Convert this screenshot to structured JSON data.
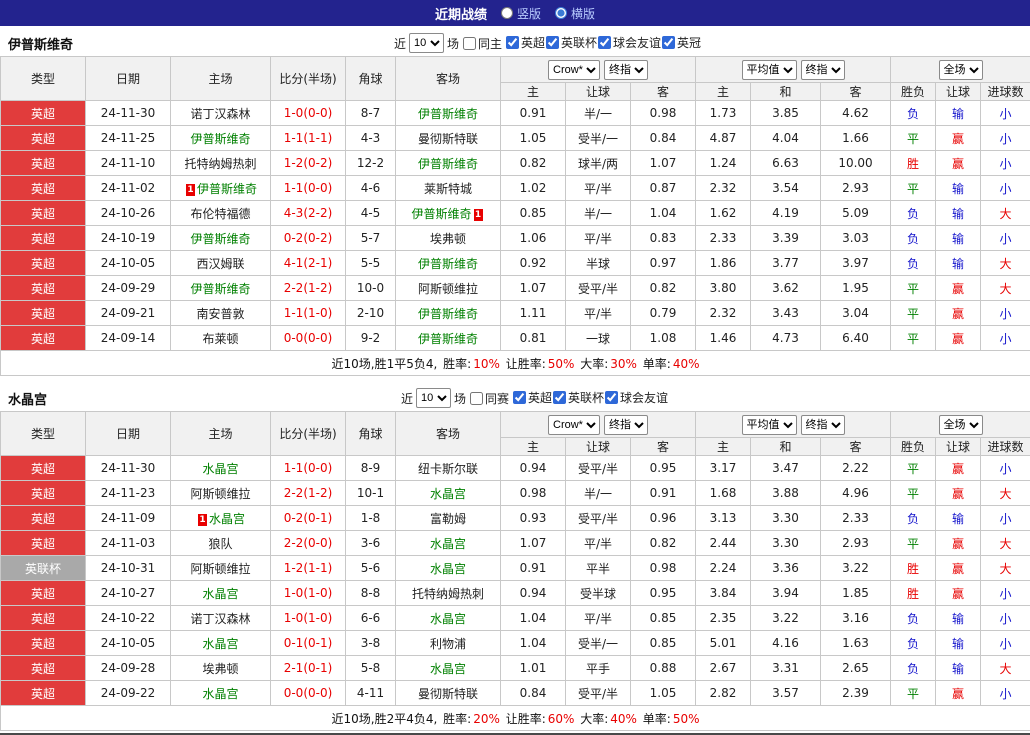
{
  "topbar": {
    "title": "近期战绩",
    "layout_options": {
      "vertical": "竖版",
      "horizontal": "横版"
    },
    "layout_selected": "横版"
  },
  "colors": {
    "accent_bar": "#23238e",
    "focus_team": "#008000",
    "score": "#e80000",
    "value_colors": {
      "胜": "#e80000",
      "平": "#008000",
      "负": "#1414cc",
      "赢": "#e80000",
      "输": "#1414cc",
      "大": "#e80000",
      "小": "#1414cc"
    },
    "type_colors": {
      "英超": "#e13c3c",
      "英联杯": "#a9a9a9"
    }
  },
  "table_header": {
    "cols": [
      "类型",
      "日期",
      "主场",
      "比分(半场)",
      "角球",
      "客场"
    ],
    "group1": {
      "select1": "Crow*",
      "select2": "终指",
      "subs": [
        "主",
        "让球",
        "客"
      ]
    },
    "group2": {
      "select1": "平均值",
      "select2": "终指",
      "subs": [
        "主",
        "和",
        "客"
      ]
    },
    "group3": {
      "select": "全场",
      "subs": [
        "胜负",
        "让球",
        "进球数"
      ]
    }
  },
  "sections": [
    {
      "team": "伊普斯维奇",
      "filter": {
        "near_label": "近",
        "count": "10",
        "matches_label": "场",
        "same_label": "同主",
        "same_checked": false,
        "leagues": [
          {
            "label": "英超",
            "checked": true
          },
          {
            "label": "英联杯",
            "checked": true
          },
          {
            "label": "球会友谊",
            "checked": true
          },
          {
            "label": "英冠",
            "checked": true
          }
        ]
      },
      "rows": [
        {
          "type": "英超",
          "date": "24-11-30",
          "home": {
            "name": "诺丁汉森林"
          },
          "score": "1-0(0-0)",
          "corner": "8-7",
          "away": {
            "name": "伊普斯维奇",
            "focus": true
          },
          "odds": [
            "0.91",
            "半/一",
            "0.98"
          ],
          "avg": [
            "1.73",
            "3.85",
            "4.62"
          ],
          "result": "负",
          "handicap_result": "输",
          "goals": "小"
        },
        {
          "type": "英超",
          "date": "24-11-25",
          "home": {
            "name": "伊普斯维奇",
            "focus": true
          },
          "score": "1-1(1-1)",
          "corner": "4-3",
          "away": {
            "name": "曼彻斯特联"
          },
          "odds": [
            "1.05",
            "受半/一",
            "0.84"
          ],
          "avg": [
            "4.87",
            "4.04",
            "1.66"
          ],
          "result": "平",
          "handicap_result": "赢",
          "goals": "小"
        },
        {
          "type": "英超",
          "date": "24-11-10",
          "home": {
            "name": "托特纳姆热刺"
          },
          "score": "1-2(0-2)",
          "corner": "12-2",
          "away": {
            "name": "伊普斯维奇",
            "focus": true
          },
          "odds": [
            "0.82",
            "球半/两",
            "1.07"
          ],
          "avg": [
            "1.24",
            "6.63",
            "10.00"
          ],
          "result": "胜",
          "handicap_result": "赢",
          "goals": "小"
        },
        {
          "type": "英超",
          "date": "24-11-02",
          "home": {
            "name": "伊普斯维奇",
            "focus": true,
            "card": "1",
            "card_pos": "left"
          },
          "score": "1-1(0-0)",
          "corner": "4-6",
          "away": {
            "name": "莱斯特城"
          },
          "odds": [
            "1.02",
            "平/半",
            "0.87"
          ],
          "avg": [
            "2.32",
            "3.54",
            "2.93"
          ],
          "result": "平",
          "handicap_result": "输",
          "goals": "小"
        },
        {
          "type": "英超",
          "date": "24-10-26",
          "home": {
            "name": "布伦特福德"
          },
          "score": "4-3(2-2)",
          "corner": "4-5",
          "away": {
            "name": "伊普斯维奇",
            "focus": true,
            "card": "1",
            "card_pos": "right"
          },
          "odds": [
            "0.85",
            "半/一",
            "1.04"
          ],
          "avg": [
            "1.62",
            "4.19",
            "5.09"
          ],
          "result": "负",
          "handicap_result": "输",
          "goals": "大"
        },
        {
          "type": "英超",
          "date": "24-10-19",
          "home": {
            "name": "伊普斯维奇",
            "focus": true
          },
          "score": "0-2(0-2)",
          "corner": "5-7",
          "away": {
            "name": "埃弗顿"
          },
          "odds": [
            "1.06",
            "平/半",
            "0.83"
          ],
          "avg": [
            "2.33",
            "3.39",
            "3.03"
          ],
          "result": "负",
          "handicap_result": "输",
          "goals": "小"
        },
        {
          "type": "英超",
          "date": "24-10-05",
          "home": {
            "name": "西汉姆联"
          },
          "score": "4-1(2-1)",
          "corner": "5-5",
          "away": {
            "name": "伊普斯维奇",
            "focus": true
          },
          "odds": [
            "0.92",
            "半球",
            "0.97"
          ],
          "avg": [
            "1.86",
            "3.77",
            "3.97"
          ],
          "result": "负",
          "handicap_result": "输",
          "goals": "大"
        },
        {
          "type": "英超",
          "date": "24-09-29",
          "home": {
            "name": "伊普斯维奇",
            "focus": true
          },
          "score": "2-2(1-2)",
          "corner": "10-0",
          "away": {
            "name": "阿斯顿维拉"
          },
          "odds": [
            "1.07",
            "受平/半",
            "0.82"
          ],
          "avg": [
            "3.80",
            "3.62",
            "1.95"
          ],
          "result": "平",
          "handicap_result": "赢",
          "goals": "大"
        },
        {
          "type": "英超",
          "date": "24-09-21",
          "home": {
            "name": "南安普敦"
          },
          "score": "1-1(1-0)",
          "corner": "2-10",
          "away": {
            "name": "伊普斯维奇",
            "focus": true
          },
          "odds": [
            "1.11",
            "平/半",
            "0.79"
          ],
          "avg": [
            "2.32",
            "3.43",
            "3.04"
          ],
          "result": "平",
          "handicap_result": "赢",
          "goals": "小"
        },
        {
          "type": "英超",
          "date": "24-09-14",
          "home": {
            "name": "布莱顿"
          },
          "score": "0-0(0-0)",
          "corner": "9-2",
          "away": {
            "name": "伊普斯维奇",
            "focus": true
          },
          "odds": [
            "0.81",
            "一球",
            "1.08"
          ],
          "avg": [
            "1.46",
            "4.73",
            "6.40"
          ],
          "result": "平",
          "handicap_result": "赢",
          "goals": "小"
        }
      ],
      "summary": {
        "prefix": "近10场,胜1平5负4,",
        "stats": [
          {
            "label": "胜率:",
            "value": "10%"
          },
          {
            "label": "让胜率:",
            "value": "50%"
          },
          {
            "label": "大率:",
            "value": "30%"
          },
          {
            "label": "单率:",
            "value": "40%"
          }
        ]
      }
    },
    {
      "team": "水晶宫",
      "filter": {
        "near_label": "近",
        "count": "10",
        "matches_label": "场",
        "same_label": "同赛",
        "same_checked": false,
        "leagues": [
          {
            "label": "英超",
            "checked": true
          },
          {
            "label": "英联杯",
            "checked": true
          },
          {
            "label": "球会友谊",
            "checked": true
          }
        ]
      },
      "rows": [
        {
          "type": "英超",
          "date": "24-11-30",
          "home": {
            "name": "水晶宫",
            "focus": true
          },
          "score": "1-1(0-0)",
          "corner": "8-9",
          "away": {
            "name": "纽卡斯尔联"
          },
          "odds": [
            "0.94",
            "受平/半",
            "0.95"
          ],
          "avg": [
            "3.17",
            "3.47",
            "2.22"
          ],
          "result": "平",
          "handicap_result": "赢",
          "goals": "小"
        },
        {
          "type": "英超",
          "date": "24-11-23",
          "home": {
            "name": "阿斯顿维拉"
          },
          "score": "2-2(1-2)",
          "corner": "10-1",
          "away": {
            "name": "水晶宫",
            "focus": true
          },
          "odds": [
            "0.98",
            "半/一",
            "0.91"
          ],
          "avg": [
            "1.68",
            "3.88",
            "4.96"
          ],
          "result": "平",
          "handicap_result": "赢",
          "goals": "大"
        },
        {
          "type": "英超",
          "date": "24-11-09",
          "home": {
            "name": "水晶宫",
            "focus": true,
            "card": "1",
            "card_pos": "left"
          },
          "score": "0-2(0-1)",
          "corner": "1-8",
          "away": {
            "name": "富勒姆"
          },
          "odds": [
            "0.93",
            "受平/半",
            "0.96"
          ],
          "avg": [
            "3.13",
            "3.30",
            "2.33"
          ],
          "result": "负",
          "handicap_result": "输",
          "goals": "小"
        },
        {
          "type": "英超",
          "date": "24-11-03",
          "home": {
            "name": "狼队"
          },
          "score": "2-2(0-0)",
          "corner": "3-6",
          "away": {
            "name": "水晶宫",
            "focus": true
          },
          "odds": [
            "1.07",
            "平/半",
            "0.82"
          ],
          "avg": [
            "2.44",
            "3.30",
            "2.93"
          ],
          "result": "平",
          "handicap_result": "赢",
          "goals": "大"
        },
        {
          "type": "英联杯",
          "date": "24-10-31",
          "home": {
            "name": "阿斯顿维拉"
          },
          "score": "1-2(1-1)",
          "corner": "5-6",
          "away": {
            "name": "水晶宫",
            "focus": true
          },
          "odds": [
            "0.91",
            "平半",
            "0.98"
          ],
          "avg": [
            "2.24",
            "3.36",
            "3.22"
          ],
          "result": "胜",
          "handicap_result": "赢",
          "goals": "大"
        },
        {
          "type": "英超",
          "date": "24-10-27",
          "home": {
            "name": "水晶宫",
            "focus": true
          },
          "score": "1-0(1-0)",
          "corner": "8-8",
          "away": {
            "name": "托特纳姆热刺"
          },
          "odds": [
            "0.94",
            "受半球",
            "0.95"
          ],
          "avg": [
            "3.84",
            "3.94",
            "1.85"
          ],
          "result": "胜",
          "handicap_result": "赢",
          "goals": "小"
        },
        {
          "type": "英超",
          "date": "24-10-22",
          "home": {
            "name": "诺丁汉森林"
          },
          "score": "1-0(1-0)",
          "corner": "6-6",
          "away": {
            "name": "水晶宫",
            "focus": true
          },
          "odds": [
            "1.04",
            "平/半",
            "0.85"
          ],
          "avg": [
            "2.35",
            "3.22",
            "3.16"
          ],
          "result": "负",
          "handicap_result": "输",
          "goals": "小"
        },
        {
          "type": "英超",
          "date": "24-10-05",
          "home": {
            "name": "水晶宫",
            "focus": true
          },
          "score": "0-1(0-1)",
          "corner": "3-8",
          "away": {
            "name": "利物浦"
          },
          "odds": [
            "1.04",
            "受半/一",
            "0.85"
          ],
          "avg": [
            "5.01",
            "4.16",
            "1.63"
          ],
          "result": "负",
          "handicap_result": "输",
          "goals": "小"
        },
        {
          "type": "英超",
          "date": "24-09-28",
          "home": {
            "name": "埃弗顿"
          },
          "score": "2-1(0-1)",
          "corner": "5-8",
          "away": {
            "name": "水晶宫",
            "focus": true
          },
          "odds": [
            "1.01",
            "平手",
            "0.88"
          ],
          "avg": [
            "2.67",
            "3.31",
            "2.65"
          ],
          "result": "负",
          "handicap_result": "输",
          "goals": "大"
        },
        {
          "type": "英超",
          "date": "24-09-22",
          "home": {
            "name": "水晶宫",
            "focus": true
          },
          "score": "0-0(0-0)",
          "corner": "4-11",
          "away": {
            "name": "曼彻斯特联"
          },
          "odds": [
            "0.84",
            "受平/半",
            "1.05"
          ],
          "avg": [
            "2.82",
            "3.57",
            "2.39"
          ],
          "result": "平",
          "handicap_result": "赢",
          "goals": "小"
        }
      ],
      "summary": {
        "prefix": "近10场,胜2平4负4,",
        "stats": [
          {
            "label": "胜率:",
            "value": "20%"
          },
          {
            "label": "让胜率:",
            "value": "60%"
          },
          {
            "label": "大率:",
            "value": "40%"
          },
          {
            "label": "单率:",
            "value": "50%"
          }
        ]
      }
    }
  ]
}
